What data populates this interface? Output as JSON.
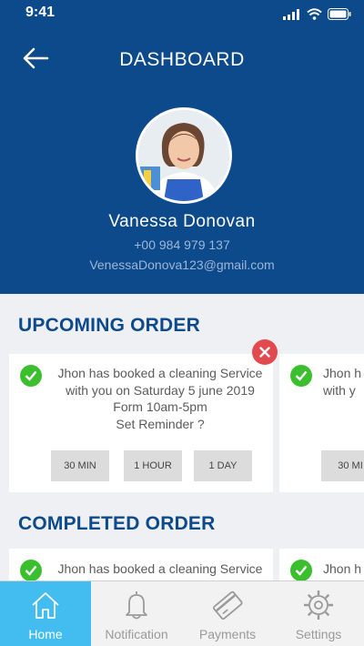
{
  "status_bar": {
    "time": "9:41"
  },
  "header": {
    "title": "DASHBOARD"
  },
  "profile": {
    "name": "Vanessa Donovan",
    "phone": "+00 984 979 137",
    "email": "VenessaDonova123@gmail.com"
  },
  "upcoming": {
    "title": "UPCOMING ORDER",
    "cards": [
      {
        "line1": "Jhon has booked a cleaning Service",
        "line2": "with you on Saturday 5 june 2019",
        "line3": "Form 10am-5pm",
        "line4": "Set Reminder ?",
        "reminders": [
          "30 MIN",
          "1 HOUR",
          "1 DAY"
        ]
      },
      {
        "line1": "Jhon h",
        "line2": "with y",
        "reminders": [
          "30 MI"
        ]
      }
    ]
  },
  "completed": {
    "title": "COMPLETED ORDER",
    "cards": [
      {
        "line1": "Jhon has booked a cleaning Service"
      },
      {
        "line1": "Jhon h"
      }
    ]
  },
  "nav": {
    "items": [
      {
        "label": "Home",
        "icon": "home-icon"
      },
      {
        "label": "Notification",
        "icon": "bell-icon"
      },
      {
        "label": "Payments",
        "icon": "credit-card-icon"
      },
      {
        "label": "Settings",
        "icon": "gear-icon"
      }
    ],
    "active": "Home"
  },
  "colors": {
    "header_bg": "#0d4a8c",
    "accent_blue": "#43bdf0",
    "success_green": "#3bbf2f",
    "danger_red": "#e24a4f"
  }
}
